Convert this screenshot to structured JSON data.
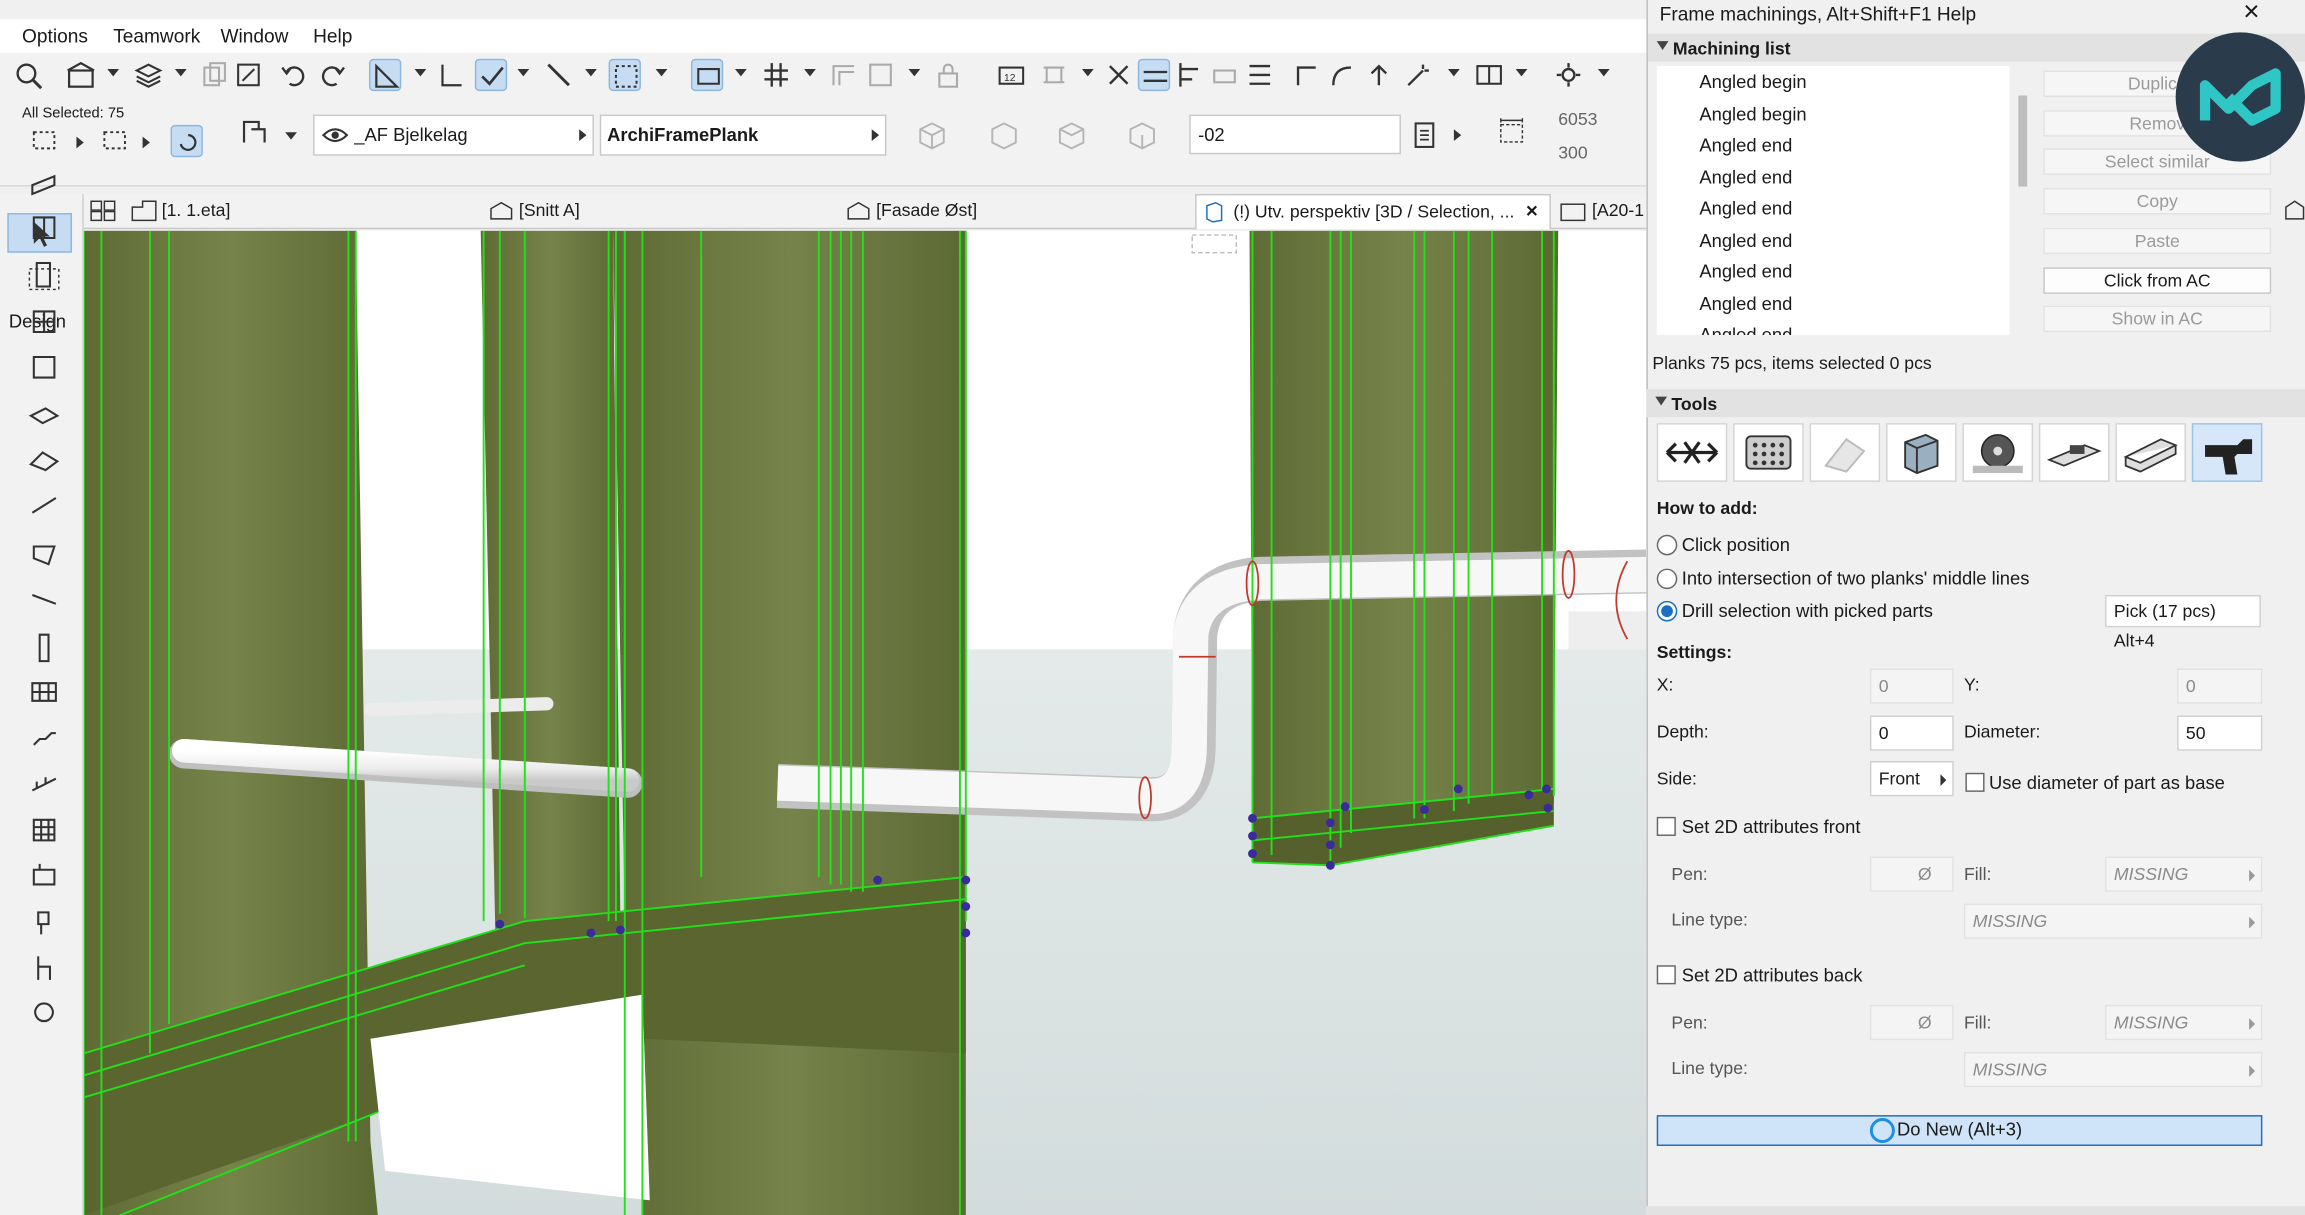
{
  "menu": {
    "items": [
      "Options",
      "Teamwork",
      "Window",
      "Help"
    ]
  },
  "selection_info": {
    "label": "All Selected: 75"
  },
  "layer": {
    "name": "_AF Bjelkelag"
  },
  "element": {
    "name": "ArchiFramePlank"
  },
  "elevation": {
    "value": "-02"
  },
  "dimensions": {
    "value1": "6053",
    "value2": "300"
  },
  "tabs": [
    {
      "label": "[1. 1.eta]"
    },
    {
      "label": "[Snitt A]"
    },
    {
      "label": "[Fasade Øst]"
    },
    {
      "label": "(!) Utv. perspektiv [3D / Selection, ..."
    },
    {
      "label": "[A20-1"
    }
  ],
  "toolbox": {
    "section_label": "Design"
  },
  "panel": {
    "title": "Frame machinings, Alt+Shift+F1 Help",
    "machining_list_header": "Machining list",
    "list_items": [
      "Angled begin",
      "Angled begin",
      "Angled end",
      "Angled end",
      "Angled end",
      "Angled end",
      "Angled end",
      "Angled end",
      "Angled end"
    ],
    "buttons": {
      "duplicate": "Duplica",
      "remove": "Remov",
      "select_similar": "Select similar",
      "copy": "Copy",
      "paste": "Paste",
      "click_from_ac": "Click from AC",
      "show_in_ac": "Show in AC"
    },
    "status": "Planks 75 pcs, items selected 0 pcs",
    "tools_header": "Tools",
    "how_to_add": "How to add:",
    "options": {
      "click_position": "Click position",
      "intersection": "Into intersection of two planks' middle lines",
      "drill_selection": "Drill selection with picked parts"
    },
    "pick_button": "Pick (17 pcs) Alt+4",
    "settings": {
      "header": "Settings:",
      "x_label": "X:",
      "x_value": "0",
      "y_label": "Y:",
      "y_value": "0",
      "depth_label": "Depth:",
      "depth_value": "0",
      "diameter_label": "Diameter:",
      "diameter_value": "50",
      "side_label": "Side:",
      "side_value": "Front",
      "use_diameter": "Use diameter of part as base"
    },
    "attr_front": {
      "label": "Set 2D attributes front",
      "pen_label": "Pen:",
      "pen_value": "Ø",
      "fill_label": "Fill:",
      "fill_value": "MISSING",
      "line_label": "Line type:",
      "line_value": "MISSING"
    },
    "attr_back": {
      "label": "Set 2D attributes back",
      "pen_label": "Pen:",
      "pen_value": "Ø",
      "fill_label": "Fill:",
      "fill_value": "MISSING",
      "line_label": "Line type:",
      "line_value": "MISSING"
    },
    "do_new_button": "Do New (Alt+3)"
  },
  "colors": {
    "accent": "#1b6ec2",
    "plank": "#6b7a3c",
    "edge": "#22e01a",
    "logo": "#2a3c4c",
    "logo_mark": "#2fc6c6"
  }
}
